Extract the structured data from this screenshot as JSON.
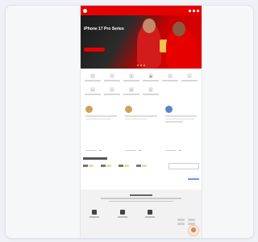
{
  "hero": {
    "title": "iPhone 17 Pro Series",
    "cta_label": ""
  },
  "quick_actions": [
    {
      "icon": "sim-icon"
    },
    {
      "icon": "wifi-icon"
    },
    {
      "icon": "phone-icon"
    },
    {
      "icon": "gift-icon"
    },
    {
      "icon": "cart-icon"
    },
    {
      "icon": "plan-icon"
    },
    {
      "icon": "card-icon"
    },
    {
      "icon": "box-icon"
    },
    {
      "icon": "roaming-icon"
    },
    {
      "icon": "device-icon"
    }
  ],
  "promos": [
    {
      "title": "",
      "avatar_color": "#c9a65e"
    },
    {
      "title": "",
      "avatar_color": "#cfa25a"
    },
    {
      "title": "",
      "avatar_color": "#5a86c9"
    }
  ],
  "colors": {
    "brand": "#e60000",
    "link": "#6b9be6"
  }
}
